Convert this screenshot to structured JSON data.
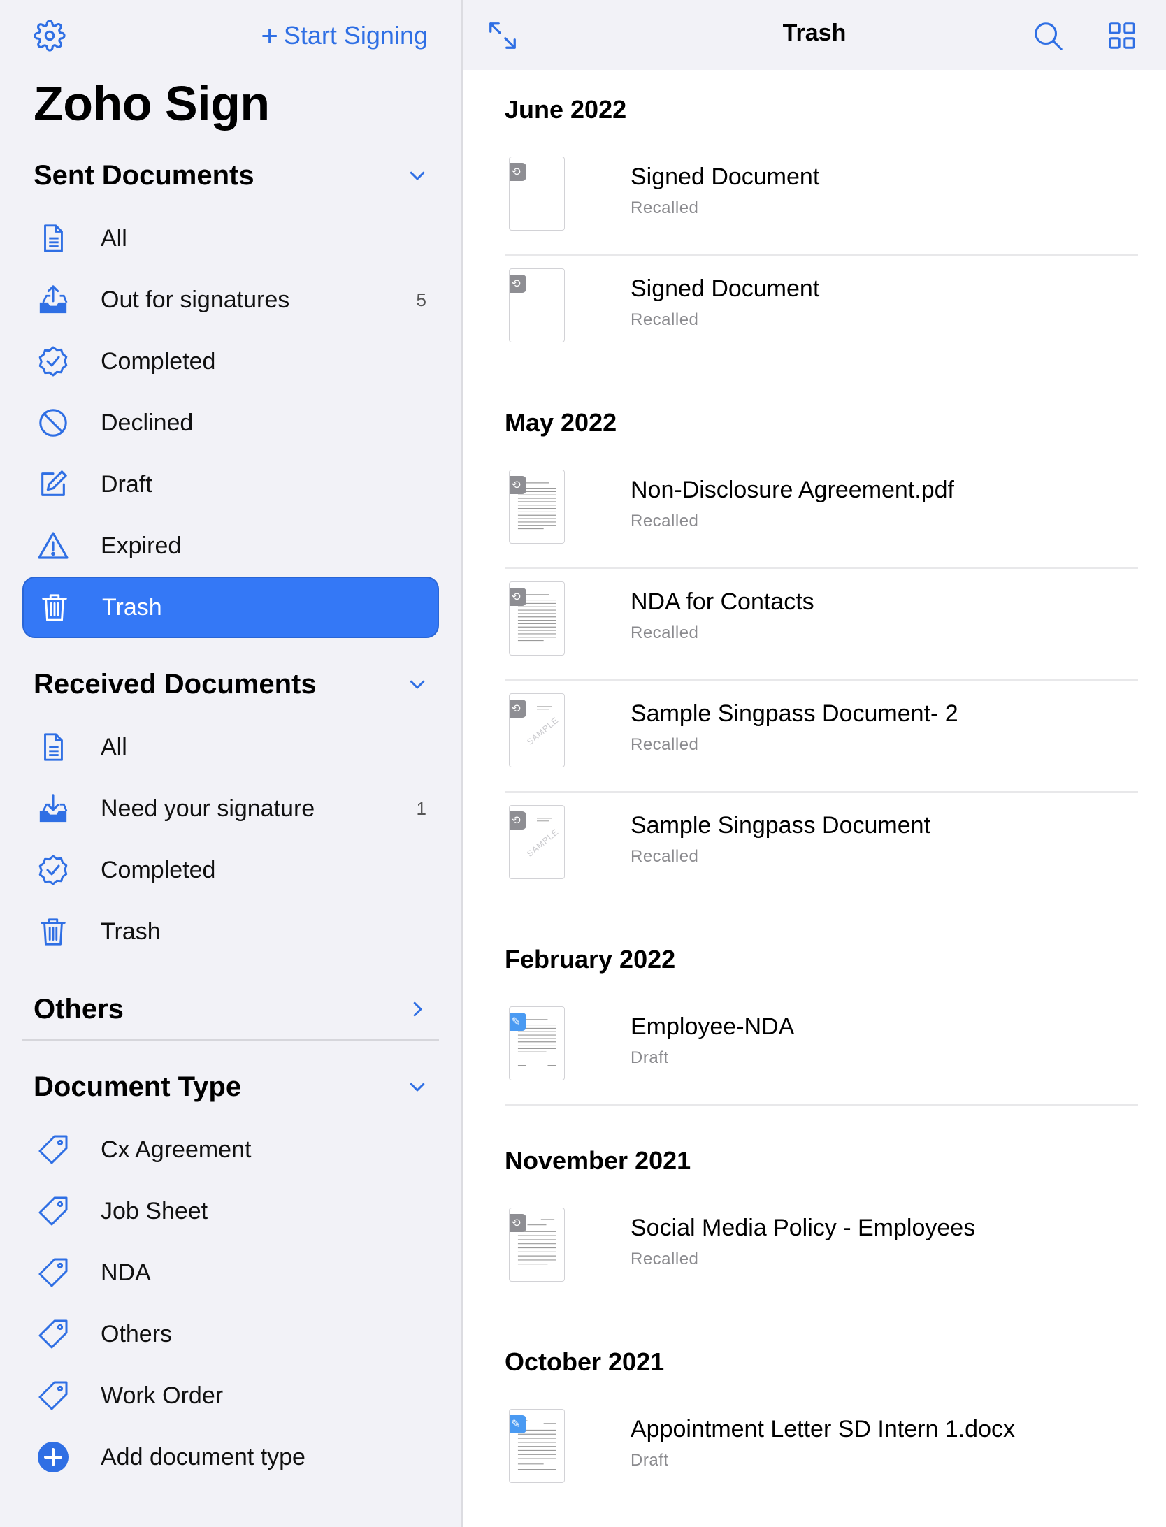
{
  "app": {
    "title": "Zoho Sign",
    "start_signing": "Start Signing"
  },
  "sidebar": {
    "sent": {
      "title": "Sent Documents",
      "items": [
        {
          "label": "All",
          "icon": "document-icon",
          "count": ""
        },
        {
          "label": "Out for signatures",
          "icon": "tray-upload-icon",
          "count": "5"
        },
        {
          "label": "Completed",
          "icon": "verified-badge-icon",
          "count": ""
        },
        {
          "label": "Declined",
          "icon": "prohibited-icon",
          "count": ""
        },
        {
          "label": "Draft",
          "icon": "edit-square-icon",
          "count": ""
        },
        {
          "label": "Expired",
          "icon": "warning-triangle-icon",
          "count": ""
        },
        {
          "label": "Trash",
          "icon": "trash-icon",
          "count": "",
          "active": true
        }
      ]
    },
    "received": {
      "title": "Received Documents",
      "items": [
        {
          "label": "All",
          "icon": "document-icon",
          "count": ""
        },
        {
          "label": "Need your signature",
          "icon": "tray-download-icon",
          "count": "1"
        },
        {
          "label": "Completed",
          "icon": "verified-badge-icon",
          "count": ""
        },
        {
          "label": "Trash",
          "icon": "trash-icon",
          "count": ""
        }
      ]
    },
    "others": {
      "title": "Others"
    },
    "doc_type": {
      "title": "Document Type",
      "items": [
        {
          "label": "Cx Agreement",
          "icon": "tag-icon"
        },
        {
          "label": "Job Sheet",
          "icon": "tag-icon"
        },
        {
          "label": "NDA",
          "icon": "tag-icon"
        },
        {
          "label": "Others",
          "icon": "tag-icon"
        },
        {
          "label": "Work Order",
          "icon": "tag-icon"
        },
        {
          "label": "Add document type",
          "icon": "plus-circle-icon"
        }
      ]
    },
    "accent_color": "#3478f6"
  },
  "main": {
    "title": "Trash",
    "groups": [
      {
        "month": "June 2022",
        "docs": [
          {
            "name": "Signed Document",
            "status": "Recalled",
            "thumb": "blank"
          },
          {
            "name": "Signed Document",
            "status": "Recalled",
            "thumb": "blank"
          }
        ]
      },
      {
        "month": "May 2022",
        "docs": [
          {
            "name": "Non-Disclosure Agreement.pdf",
            "status": "Recalled",
            "thumb": "text"
          },
          {
            "name": "NDA for Contacts",
            "status": "Recalled",
            "thumb": "text"
          },
          {
            "name": "Sample Singpass Document- 2",
            "status": "Recalled",
            "thumb": "sample"
          },
          {
            "name": "Sample Singpass Document",
            "status": "Recalled",
            "thumb": "sample"
          }
        ]
      },
      {
        "month": "February 2022",
        "docs": [
          {
            "name": "Employee-NDA",
            "status": "Draft",
            "thumb": "text"
          }
        ]
      },
      {
        "month": "November 2021",
        "docs": [
          {
            "name": "Social Media Policy - Employees",
            "status": "Recalled",
            "thumb": "text"
          }
        ]
      },
      {
        "month": "October 2021",
        "docs": [
          {
            "name": "Appointment Letter SD Intern 1.docx",
            "status": "Draft",
            "thumb": "text"
          }
        ]
      }
    ]
  }
}
